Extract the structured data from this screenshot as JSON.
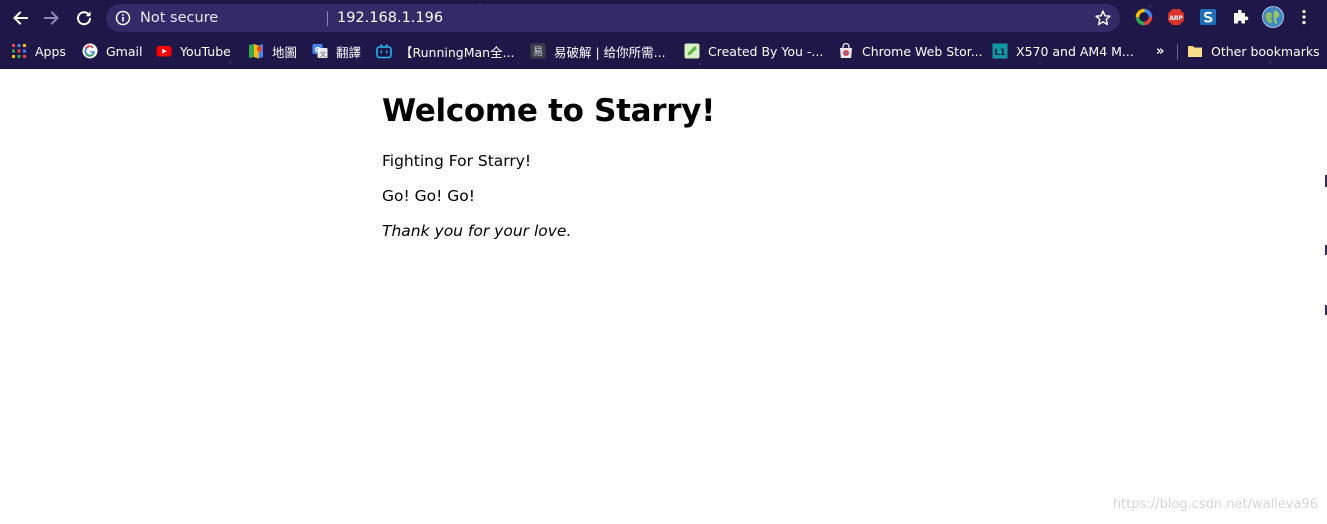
{
  "omnibox": {
    "security_label": "Not secure",
    "url": "192.168.1.196"
  },
  "bookmarks": {
    "items": [
      {
        "label": "Apps",
        "icon": "apps-grid-icon"
      },
      {
        "label": "Gmail",
        "icon": "google-icon"
      },
      {
        "label": "YouTube",
        "icon": "youtube-icon"
      },
      {
        "label": "地圖",
        "icon": "maps-icon"
      },
      {
        "label": "翻譯",
        "icon": "translate-icon"
      },
      {
        "label": "【RunningMan全...",
        "icon": "bilibili-icon"
      },
      {
        "label": "易破解 | 给你所需...",
        "icon": "site-yi-icon"
      },
      {
        "label": "Created By You -...",
        "icon": "pencil-icon"
      },
      {
        "label": "Chrome Web Stor...",
        "icon": "webstore-icon"
      },
      {
        "label": "X570 and AM4 M...",
        "icon": "l1-icon"
      }
    ],
    "overflow": "»",
    "other": "Other bookmarks"
  },
  "page": {
    "heading": "Welcome to Starry!",
    "line1": "Fighting For Starry!",
    "line2": "Go! Go! Go!",
    "line3": "Thank you for your love."
  },
  "watermark": "https://blog.csdn.net/walleva96",
  "colors": {
    "chrome_bg": "#1e1748",
    "omnibox_bg": "#332a67",
    "page_bg": "#ffffff"
  }
}
